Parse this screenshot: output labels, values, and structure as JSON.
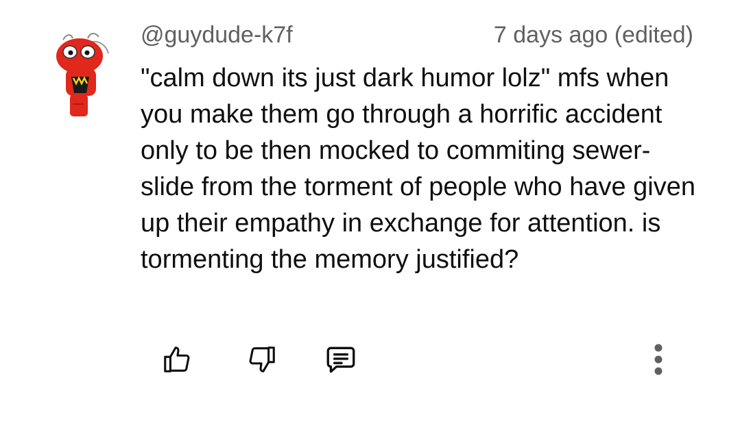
{
  "comment": {
    "username": "@guydude-k7f",
    "timestamp": "7 days ago (edited)",
    "text": "\"calm down its just dark humor lolz\" mfs when you make them go through a horrific accident only to be then mocked to commiting sewer-slide from the torment of people who have given up their empathy in exchange for attention. is tormenting the memory justified?"
  },
  "avatar": {
    "description_icon": "red-cartoon-character-avatar",
    "color": "#e0281c"
  },
  "actions": {
    "like_icon": "thumbs-up-icon",
    "dislike_icon": "thumbs-down-icon",
    "reply_icon": "comment-icon",
    "more_icon": "more-vertical-icon"
  },
  "colors": {
    "text": "#0f0f0f",
    "meta": "#606060",
    "icon": "#0f0f0f",
    "more": "#606060"
  }
}
